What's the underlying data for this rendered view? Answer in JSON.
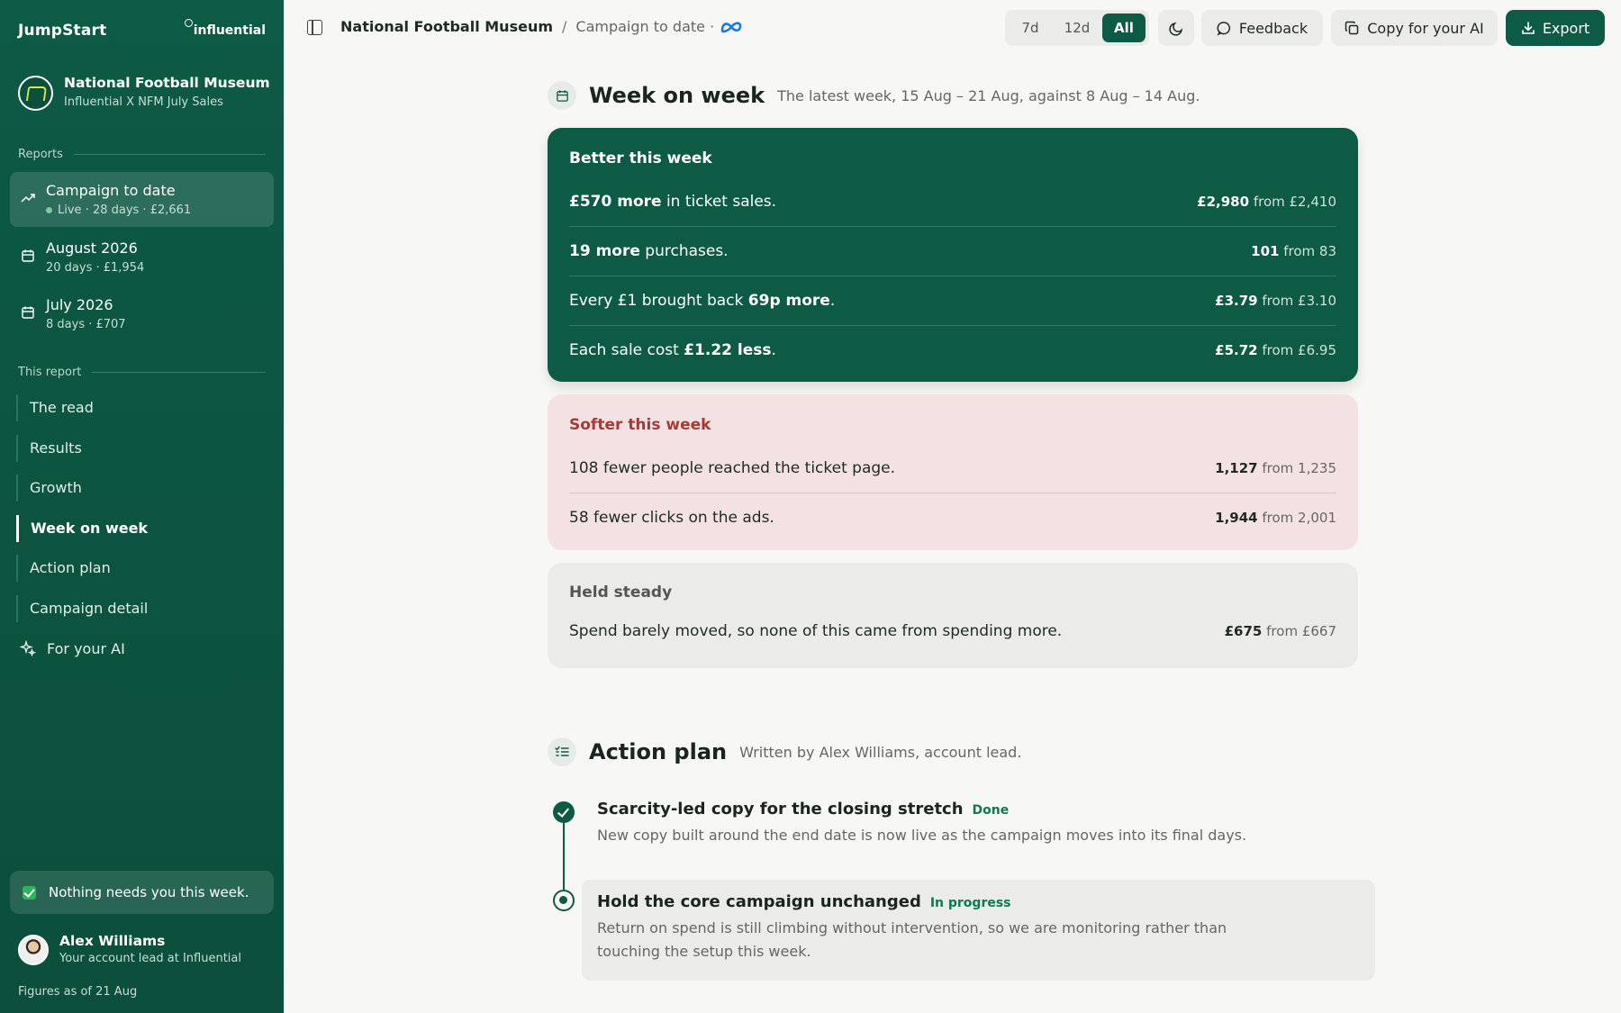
{
  "sidebar": {
    "brand": "JumpStart",
    "partner_logo": "influential",
    "client": {
      "name": "National Football Museum",
      "subtitle": "Influential X NFM July Sales"
    },
    "reports_label": "Reports",
    "reports": [
      {
        "title": "Campaign to date",
        "status": "Live",
        "meta": " · 28 days · £2,661",
        "icon": "trend-icon",
        "active": true
      },
      {
        "title": "August 2026",
        "meta": "20 days · £1,954",
        "icon": "calendar-icon"
      },
      {
        "title": "July 2026",
        "meta": "8 days · £707",
        "icon": "calendar-icon"
      }
    ],
    "this_report_label": "This report",
    "nav": [
      "The read",
      "Results",
      "Growth",
      "Week on week",
      "Action plan",
      "Campaign detail"
    ],
    "nav_active": "Week on week",
    "ai_link": "For your AI",
    "nothing_notice": "Nothing needs you this week.",
    "lead": {
      "name": "Alex Williams",
      "role": "Your account lead at Influential"
    },
    "figures_as_of": "Figures as of 21 Aug"
  },
  "topbar": {
    "breadcrumb_client": "National Football Museum",
    "breadcrumb_separator": "/",
    "breadcrumb_page": "Campaign to date ·",
    "ranges": [
      "7d",
      "12d",
      "All"
    ],
    "range_selected": "All",
    "feedback_label": "Feedback",
    "copy_label": "Copy for your AI",
    "export_label": "Export"
  },
  "week_on_week": {
    "title": "Week on week",
    "description": "The latest week, 15 Aug – 21 Aug, against 8 Aug – 14 Aug.",
    "better": {
      "title": "Better this week",
      "rows": [
        {
          "pre": "",
          "bold": "£570 more",
          "post": " in ticket sales.",
          "now": "£2,980",
          "from": " from £2,410"
        },
        {
          "pre": "",
          "bold": "19 more",
          "post": " purchases.",
          "now": "101",
          "from": " from 83"
        },
        {
          "pre": "Every £1 brought back ",
          "bold": "69p more",
          "post": ".",
          "now": "£3.79",
          "from": " from £3.10"
        },
        {
          "pre": "Each sale cost ",
          "bold": "£1.22 less",
          "post": ".",
          "now": "£5.72",
          "from": " from £6.95"
        }
      ]
    },
    "softer": {
      "title": "Softer this week",
      "rows": [
        {
          "text": "108 fewer people reached the ticket page.",
          "now": "1,127",
          "from": " from 1,235"
        },
        {
          "text": "58 fewer clicks on the ads.",
          "now": "1,944",
          "from": " from 2,001"
        }
      ]
    },
    "steady": {
      "title": "Held steady",
      "rows": [
        {
          "text": "Spend barely moved, so none of this came from spending more.",
          "now": "£675",
          "from": " from £667"
        }
      ]
    }
  },
  "action_plan": {
    "title": "Action plan",
    "description": "Written by Alex Williams, account lead.",
    "steps": [
      {
        "title": "Scarcity-led copy for the closing stretch",
        "status": "Done",
        "text": "New copy built around the end date is now live as the campaign moves into its final days."
      },
      {
        "title": "Hold the core campaign unchanged",
        "status": "In progress",
        "text": "Return on spend is still climbing without intervention, so we are monitoring rather than touching the setup this week."
      }
    ]
  },
  "colors": {
    "brand_green": "#0d5a45",
    "softer_red": "#a83a36",
    "done_green": "#0d7a50"
  }
}
